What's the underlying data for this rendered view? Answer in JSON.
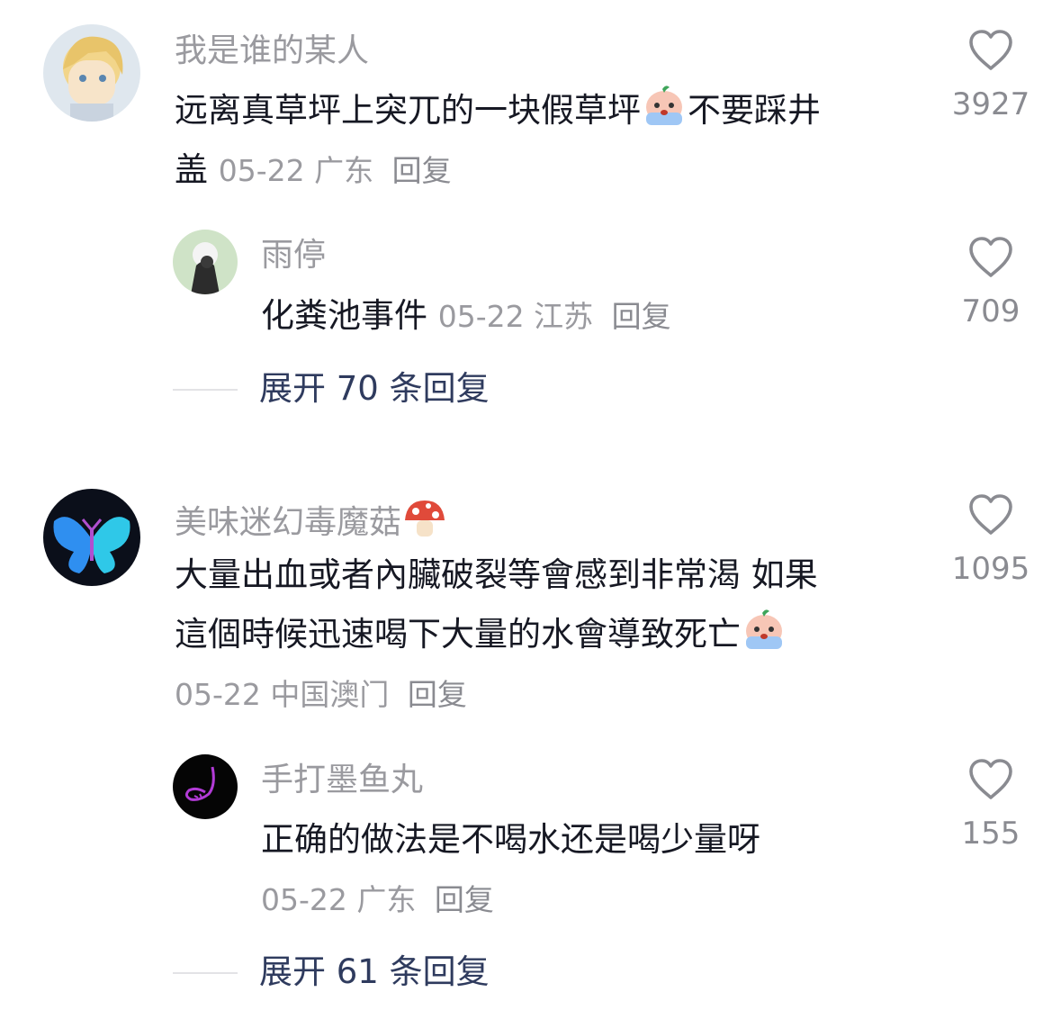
{
  "comments": [
    {
      "username": "我是谁的某人",
      "text_line1": "远离真草坪上突兀的一块假草坪",
      "text_line1b": "不要踩井",
      "text_line2": "盖",
      "date": "05-22",
      "location": "广东",
      "reply": "回复",
      "likes": "3927",
      "avatar_icon": "anime-avatar-icon",
      "replies": [
        {
          "username": "雨停",
          "text": "化粪池事件",
          "date": "05-22",
          "location": "江苏",
          "reply": "回复",
          "likes": "709",
          "avatar_icon": "photo-avatar-icon"
        }
      ],
      "expand_label": "展开 70 条回复"
    },
    {
      "username": "美味迷幻毒魔菇",
      "username_emoji": "mushroom-emoji",
      "text_line1": "大量出血或者內臟破裂等會感到非常渴 如果",
      "text_line2": "這個時候迅速喝下大量的水會導致死亡",
      "date": "05-22",
      "location": "中国澳门",
      "reply": "回复",
      "likes": "1095",
      "avatar_icon": "butterfly-avatar-icon",
      "replies": [
        {
          "username": "手打墨鱼丸",
          "text": "正确的做法是不喝水还是喝少量呀",
          "date": "05-22",
          "location": "广东",
          "reply": "回复",
          "likes": "155",
          "avatar_icon": "sketch-avatar-icon"
        }
      ],
      "expand_label": "展开 61 条回复"
    }
  ],
  "colors": {
    "text": "#161823",
    "secondary": "#9a9a9f",
    "expand": "#2f3b5e",
    "divider": "#e3e3e6"
  }
}
